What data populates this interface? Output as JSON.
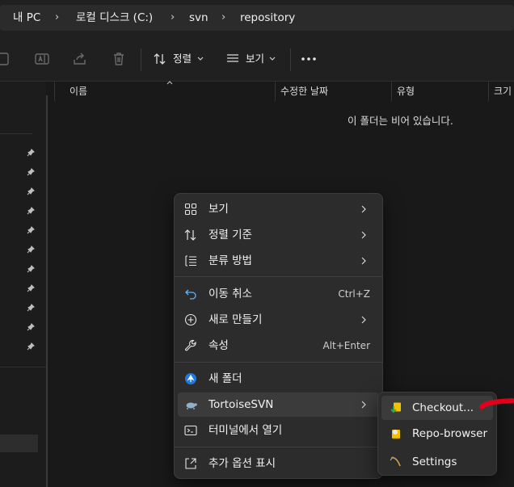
{
  "address": {
    "crumbs": [
      "내 PC",
      "로컬 디스크 (C:)",
      "svn",
      "repository"
    ]
  },
  "toolbar": {
    "sort_label": "정렬",
    "view_label": "보기",
    "more_label": "..."
  },
  "columns": {
    "name": "이름",
    "modified": "수정한 날짜",
    "type": "유형",
    "size": "크기"
  },
  "empty_message": "이 폴더는 비어 있습니다.",
  "context_menu": {
    "items": [
      {
        "label": "보기",
        "icon": "grid-icon",
        "submenu": true
      },
      {
        "label": "정렬 기준",
        "icon": "sort-icon",
        "submenu": true
      },
      {
        "label": "분류 방법",
        "icon": "group-list-icon",
        "submenu": true
      },
      {
        "label": "이동 취소",
        "icon": "undo-icon",
        "shortcut": "Ctrl+Z"
      },
      {
        "label": "새로 만들기",
        "icon": "new-plus-icon",
        "submenu": true
      },
      {
        "label": "속성",
        "icon": "wrench-icon",
        "shortcut": "Alt+Enter"
      },
      {
        "label": "새 폴더",
        "icon": "tortoise-new-folder-icon"
      },
      {
        "label": "TortoiseSVN",
        "icon": "tortoisesvn-icon",
        "submenu": true,
        "highlighted": true
      },
      {
        "label": "터미널에서 열기",
        "icon": "terminal-icon"
      },
      {
        "label": "추가 옵션 표시",
        "icon": "expand-icon"
      }
    ]
  },
  "svn_submenu": {
    "items": [
      {
        "label": "Checkout...",
        "icon": "checkout-icon",
        "highlighted": true
      },
      {
        "label": "Repo-browser",
        "icon": "repo-browser-icon"
      },
      {
        "label": "Settings",
        "icon": "settings-icon"
      }
    ]
  },
  "colors": {
    "background": "#191919",
    "menu_bg": "#2c2c2c",
    "highlight": "#3b3b3b",
    "annotation": "#e0001b"
  }
}
